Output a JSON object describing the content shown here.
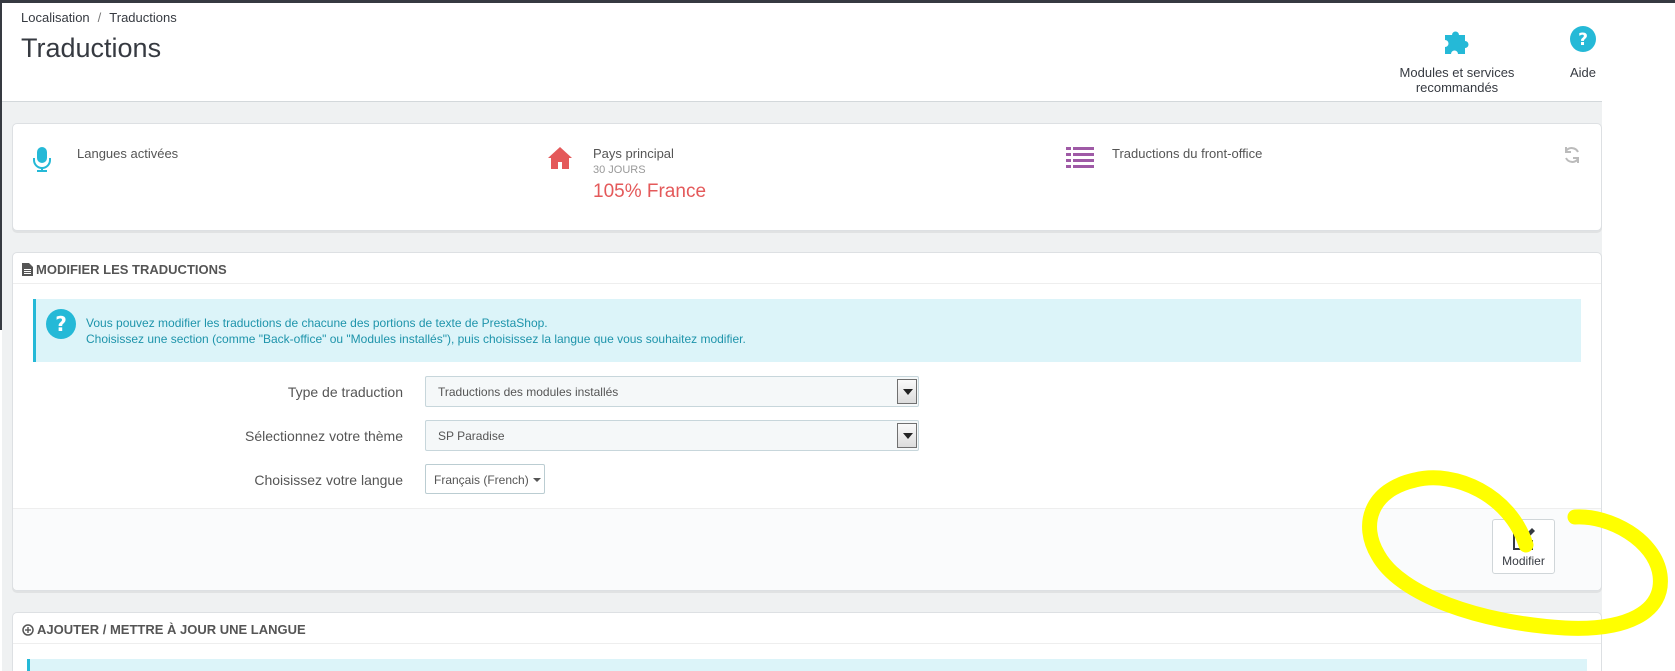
{
  "breadcrumb": {
    "parent": "Localisation",
    "separator": "/",
    "current": "Traductions"
  },
  "page_title": "Traductions",
  "toolbar": {
    "modules_label": "Modules et services recommandés",
    "modules_icon": "puzzle-icon",
    "help_label": "Aide",
    "help_icon": "help-circle-icon"
  },
  "kpis": [
    {
      "icon": "microphone-icon",
      "title": "Langues activées",
      "subtitle": "",
      "value": ""
    },
    {
      "icon": "home-icon",
      "title": "Pays principal",
      "subtitle": "30 JOURS",
      "value": "105% France"
    },
    {
      "icon": "list-icon",
      "title": "Traductions du front-office",
      "subtitle": "",
      "value": ""
    }
  ],
  "edit_panel": {
    "heading": "MODIFIER LES TRADUCTIONS",
    "alert_line1": "Vous pouvez modifier les traductions de chacune des portions de texte de PrestaShop.",
    "alert_line2": "Choisissez une section (comme \"Back-office\" ou \"Modules installés\"), puis choisissez la langue que vous souhaitez modifier.",
    "type_label": "Type de traduction",
    "type_value": "Traductions des modules installés",
    "theme_label": "Sélectionnez votre thème",
    "theme_value": "SP Paradise",
    "language_label": "Choisissez votre langue",
    "language_value": "Français (French)",
    "modify_button": "Modifier"
  },
  "add_panel": {
    "heading": "AJOUTER / METTRE À JOUR UNE LANGUE"
  },
  "colors": {
    "accent": "#25b9d7",
    "kpi_value": "#e4595a",
    "kpi_home_icon": "#e4595a",
    "kpi_list_icon": "#9f5aa6",
    "alert_bg": "#dcf4f9",
    "highlight_annotation": "#ffff00"
  }
}
